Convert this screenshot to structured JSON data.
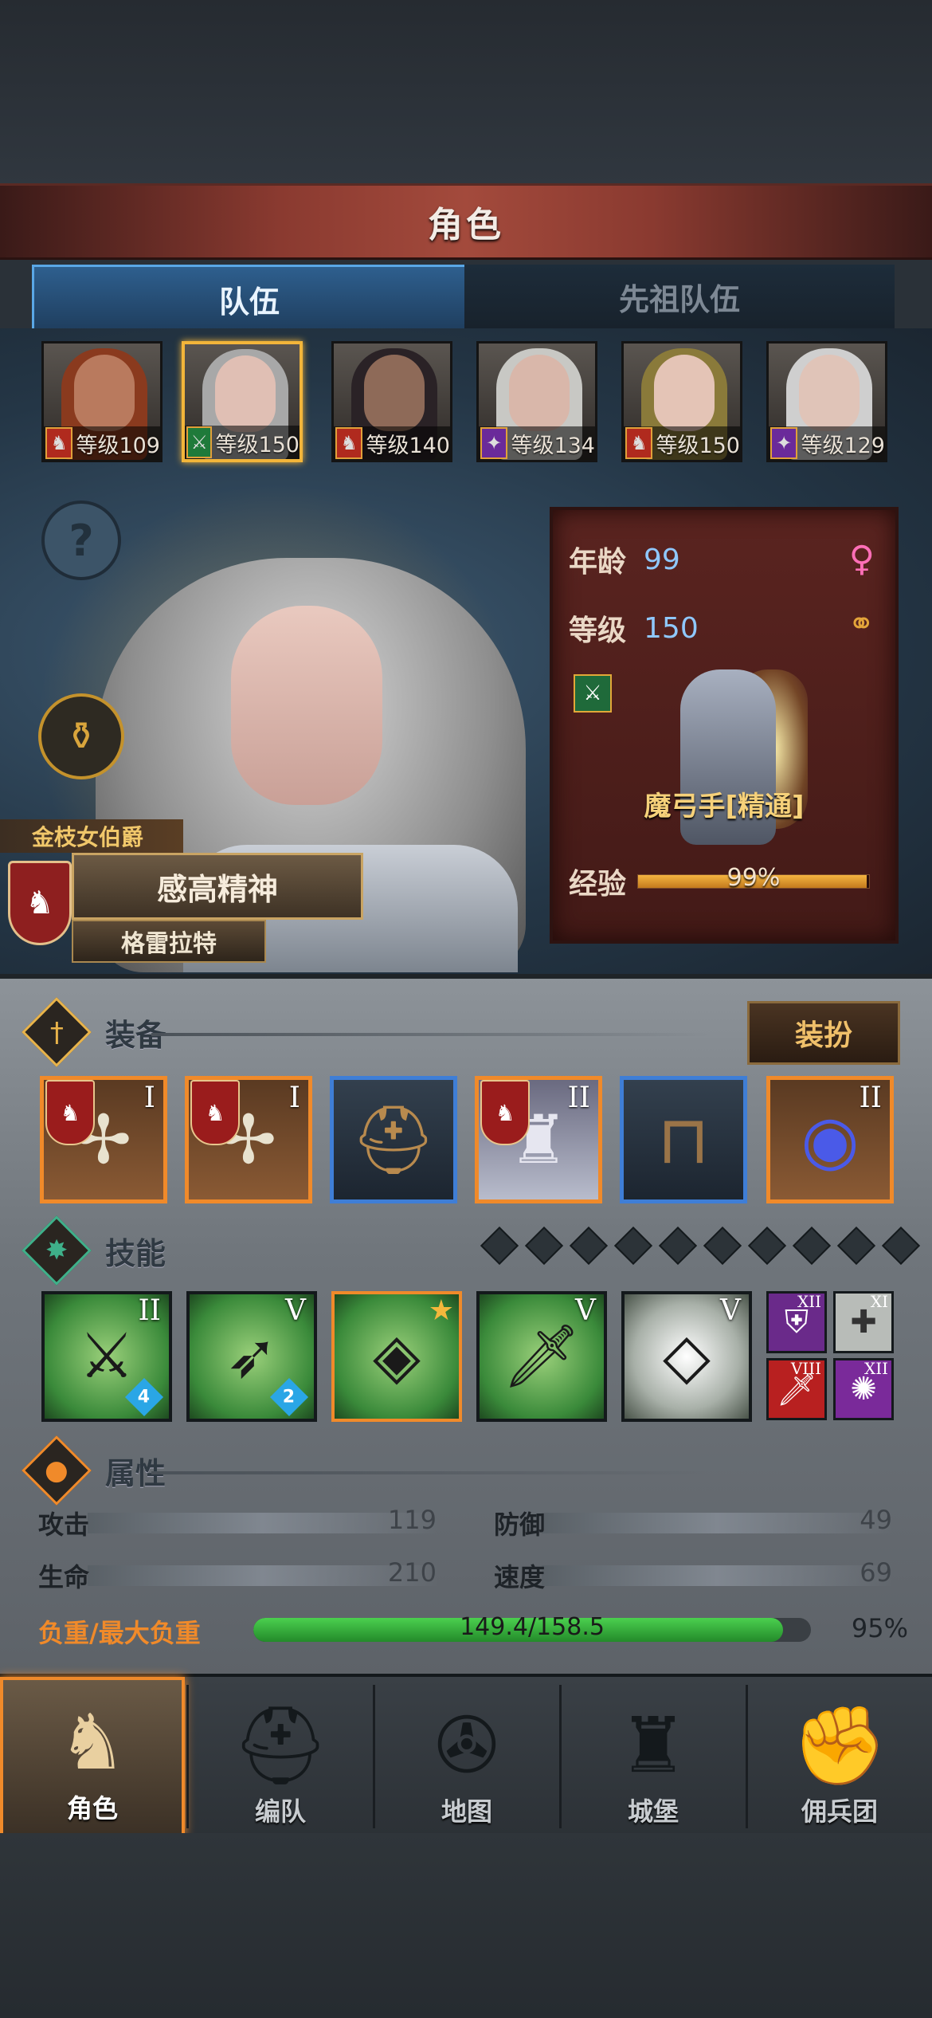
{
  "header": {
    "title": "角色"
  },
  "tabs": [
    {
      "label": "队伍"
    },
    {
      "label": "先祖队伍"
    }
  ],
  "roster": [
    {
      "level": "等级109",
      "class_icon": "horse-icon"
    },
    {
      "level": "等级150",
      "class_icon": "crossbow-icon"
    },
    {
      "level": "等级140",
      "class_icon": "horse-icon"
    },
    {
      "level": "等级134",
      "class_icon": "staff-icon"
    },
    {
      "level": "等级150",
      "class_icon": "horse-icon"
    },
    {
      "level": "等级129",
      "class_icon": "staff-icon"
    }
  ],
  "hero": {
    "title": "金枝女伯爵",
    "trait": "感高精神",
    "name": "格雷拉特"
  },
  "info": {
    "age_label": "年龄",
    "age": "99",
    "level_label": "等级",
    "level": "150",
    "class_name": "魔弓手[精通]",
    "exp_label": "经验",
    "exp_text": "99%",
    "exp_fraction": 0.99
  },
  "equipment": {
    "title": "装备",
    "dress_button": "装扮",
    "items": [
      {
        "rank": "I",
        "rarity": "orange",
        "icon": "crossbow-icon",
        "banner": true
      },
      {
        "rank": "I",
        "rarity": "orange",
        "icon": "crossbow-icon",
        "banner": true
      },
      {
        "rank": "",
        "rarity": "blue",
        "icon": "helmet-icon",
        "banner": false
      },
      {
        "rank": "II",
        "rarity": "orange",
        "icon": "armor-icon",
        "banner": true
      },
      {
        "rank": "",
        "rarity": "blue",
        "icon": "boots-icon",
        "banner": false
      },
      {
        "rank": "II",
        "rarity": "orange",
        "icon": "orb-icon",
        "banner": false
      }
    ]
  },
  "skills": {
    "title": "技能",
    "slots_total": 10,
    "main": [
      {
        "rank": "II",
        "count": "4",
        "icon": "sword-aura-icon"
      },
      {
        "rank": "V",
        "count": "2",
        "icon": "crossbow-cursor-icon"
      },
      {
        "rank": "",
        "count": "",
        "icon": "crystal-spear-icon",
        "star": true
      },
      {
        "rank": "V",
        "count": "",
        "icon": "sword-hand-icon"
      },
      {
        "rank": "V",
        "count": "",
        "icon": "crystal-hand-icon"
      }
    ],
    "mini": [
      {
        "rank": "XII",
        "icon": "shield-icon",
        "color": "#6a2a8a"
      },
      {
        "rank": "XI",
        "icon": "cross-icon",
        "color": "#b8bcb8"
      },
      {
        "rank": "VIII",
        "icon": "blade-icon",
        "color": "#b82020"
      },
      {
        "rank": "XII",
        "icon": "sparkle-icon",
        "color": "#7a2a9a"
      }
    ]
  },
  "attributes": {
    "title": "属性",
    "attack_label": "攻击",
    "attack": "119",
    "defense_label": "防御",
    "defense": "49",
    "hp_label": "生命",
    "hp": "210",
    "speed_label": "速度",
    "speed": "69",
    "load_label": "负重/最大负重",
    "load_text": "149.4/158.5",
    "load_pct": "95%",
    "load_fraction": 0.95
  },
  "nav": [
    {
      "label": "角色",
      "icon": "knight-icon"
    },
    {
      "label": "编队",
      "icon": "helmet-icon"
    },
    {
      "label": "地图",
      "icon": "compass-icon"
    },
    {
      "label": "城堡",
      "icon": "castle-icon"
    },
    {
      "label": "佣兵团",
      "icon": "fist-icon"
    }
  ]
}
